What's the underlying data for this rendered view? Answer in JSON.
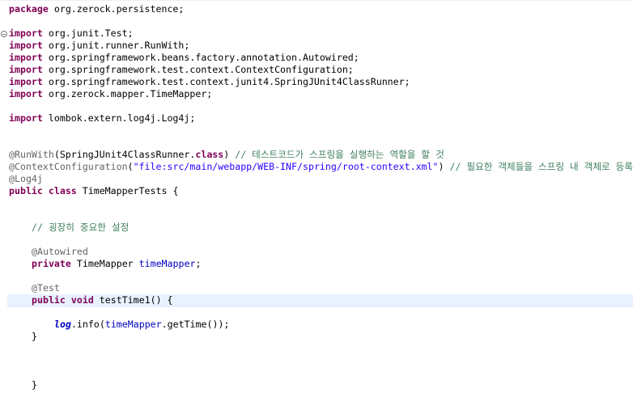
{
  "editor": {
    "lines": {
      "package": {
        "kw": "package",
        "text": " org.zerock.persistence;"
      },
      "import1": {
        "kw": "import",
        "text": " org.junit.Test;"
      },
      "import2": {
        "kw": "import",
        "text": " org.junit.runner.RunWith;"
      },
      "import3": {
        "kw": "import",
        "text": " org.springframework.beans.factory.annotation.Autowired;"
      },
      "import4": {
        "kw": "import",
        "text": " org.springframework.test.context.ContextConfiguration;"
      },
      "import5": {
        "kw": "import",
        "text": " org.springframework.test.context.junit4.SpringJUnit4ClassRunner;"
      },
      "import6": {
        "kw": "import",
        "text": " org.zerock.mapper.TimeMapper;"
      },
      "import7": {
        "kw": "import",
        "text": " lombok.extern.log4j.Log4j;"
      },
      "runwith": {
        "ann": "@RunWith",
        "mid1": "(SpringJUnit4ClassRunner.",
        "kw": "class",
        "mid2": ") ",
        "comment": "// 테스트코드가 스프링을 실행하는 역할을 할 것"
      },
      "contextconfig": {
        "ann": "@ContextConfiguration",
        "open": "(",
        "str": "\"file:src/main/webapp/WEB-INF/spring/root-context.xml\"",
        "close": ") ",
        "comment": "// 필요한 객체들을 스프링 내 객체로 등록"
      },
      "log4j": {
        "ann": "@Log4j"
      },
      "classdecl": {
        "kw1": "public",
        "kw2": "class",
        "text": " TimeMapperTests {"
      },
      "comment_setting": {
        "comment": "// 굉장히 중요한 설정"
      },
      "autowired": {
        "ann": "@Autowired"
      },
      "field": {
        "kw": "private",
        "type": " TimeMapper ",
        "name": "timeMapper",
        "semi": ";"
      },
      "test_ann": {
        "ann": "@Test"
      },
      "method": {
        "kw1": "public",
        "kw2": "void",
        "text": " testTime1() {"
      },
      "log_call": {
        "log": "log",
        "dot": ".info(",
        "field": "timeMapper",
        "rest": ".getTime());"
      },
      "close_method": {
        "text": "}"
      },
      "close_class": {
        "text": "}"
      }
    }
  }
}
